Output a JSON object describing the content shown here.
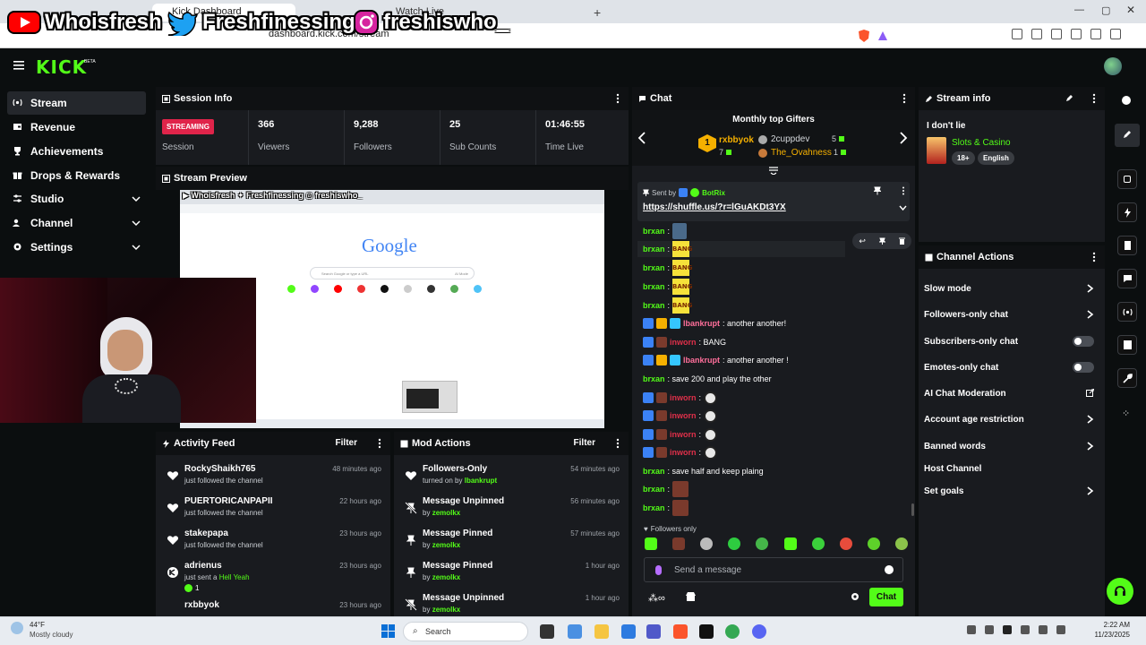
{
  "browser": {
    "tabs": [
      "Kick Dashboard",
      "Watch Live"
    ],
    "url": "dashboard.kick.com/stream"
  },
  "overlay": {
    "youtube": "Whoisfresh",
    "twitter": "Freshfinessing",
    "instagram": "freshiswho_"
  },
  "app": {
    "logo": "KICK",
    "logo_sup": "BETA"
  },
  "sidebar": {
    "items": [
      {
        "label": "Stream"
      },
      {
        "label": "Revenue"
      },
      {
        "label": "Achievements"
      },
      {
        "label": "Drops & Rewards"
      },
      {
        "label": "Studio"
      },
      {
        "label": "Channel"
      },
      {
        "label": "Settings"
      }
    ]
  },
  "session": {
    "title": "Session Info",
    "status": "STREAMING",
    "status_label": "Session",
    "stats": [
      {
        "value": "366",
        "label": "Viewers"
      },
      {
        "value": "9,288",
        "label": "Followers"
      },
      {
        "value": "25",
        "label": "Sub Counts"
      },
      {
        "value": "01:46:55",
        "label": "Time Live"
      }
    ]
  },
  "preview": {
    "title": "Stream Preview",
    "google_logo": "Google",
    "search_placeholder": "Search Google or type a URL",
    "ai_mode": "AI Mode"
  },
  "activity": {
    "title": "Activity Feed",
    "filter": "Filter",
    "items": [
      {
        "name": "RockyShaikh765",
        "sub": "just followed the channel",
        "ago": "48 minutes ago"
      },
      {
        "name": "PUERTORICANPAPII",
        "sub": "just followed the channel",
        "ago": "22 hours ago"
      },
      {
        "name": "stakepapa",
        "sub": "just followed the channel",
        "ago": "23 hours ago"
      },
      {
        "name": "adrienus",
        "sub": "just sent a",
        "sub_green": "Hell Yeah",
        "count": "1",
        "ago": "23 hours ago"
      },
      {
        "name": "rxbbyok",
        "ago": "23 hours ago"
      }
    ]
  },
  "mod": {
    "title": "Mod Actions",
    "filter": "Filter",
    "items": [
      {
        "name": "Followers-Only",
        "sub": "turned on by",
        "user": "lbankrupt",
        "ago": "54 minutes ago"
      },
      {
        "name": "Message Unpinned",
        "sub": "by",
        "user": "zemolkx",
        "ago": "56 minutes ago"
      },
      {
        "name": "Message Pinned",
        "sub": "by",
        "user": "zemolkx",
        "ago": "57 minutes ago"
      },
      {
        "name": "Message Pinned",
        "sub": "by",
        "user": "zemolkx",
        "ago": "1 hour ago"
      },
      {
        "name": "Message Unpinned",
        "sub": "by",
        "user": "zemolkx",
        "ago": "1 hour ago"
      }
    ]
  },
  "chat": {
    "title": "Chat",
    "gifters_title": "Monthly top Gifters",
    "gifters": [
      {
        "rank": "1",
        "name": "rxbbyok",
        "count": "7"
      },
      {
        "name": "2cuppdev",
        "count": "5"
      },
      {
        "name": "The_Ovahness",
        "count": "1"
      }
    ],
    "pinned": {
      "sent_by": "Sent by",
      "user": "BotRix",
      "link": "https://shuffle.us/?r=lGuAKDt3YX"
    },
    "lines": [
      {
        "user": "brxan",
        "text": ""
      },
      {
        "user": "brxan",
        "text": "BANG"
      },
      {
        "user": "brxan",
        "text": "BANG"
      },
      {
        "user": "brxan",
        "text": "BANG"
      },
      {
        "user": "brxan",
        "text": "BANG"
      },
      {
        "user": "lbankrupt",
        "text": ": another another!"
      },
      {
        "user": "inworn",
        "text": ": BANG"
      },
      {
        "user": "lbankrupt",
        "text": ": another another !"
      },
      {
        "user": "brxan",
        "text": ": save 200 and play the other"
      },
      {
        "user": "inworn",
        "text": ""
      },
      {
        "user": "inworn",
        "text": ""
      },
      {
        "user": "inworn",
        "text": ""
      },
      {
        "user": "inworn",
        "text": ""
      },
      {
        "user": "brxan",
        "text": ": save half and keep plaing"
      },
      {
        "user": "brxan",
        "text": ""
      },
      {
        "user": "brxan",
        "text": ""
      }
    ],
    "followers_only": "Followers only",
    "input_placeholder": "Send a message",
    "send_label": "Chat"
  },
  "stream_info": {
    "title": "Stream info",
    "stream_title": "I don't lie",
    "category": "Slots & Casino",
    "tags": [
      "18+",
      "English"
    ]
  },
  "channel_actions": {
    "title": "Channel Actions",
    "items": [
      {
        "label": "Slow mode",
        "kind": "arrow"
      },
      {
        "label": "Followers-only chat",
        "kind": "arrow"
      },
      {
        "label": "Subscribers-only chat",
        "kind": "toggle"
      },
      {
        "label": "Emotes-only chat",
        "kind": "toggle"
      },
      {
        "label": "AI Chat Moderation",
        "kind": "external"
      },
      {
        "label": "Account age restriction",
        "kind": "arrow"
      },
      {
        "label": "Banned words",
        "kind": "arrow"
      },
      {
        "label": "Host Channel",
        "kind": "none"
      },
      {
        "label": "Set goals",
        "kind": "arrow"
      }
    ]
  },
  "taskbar": {
    "weather_temp": "44°F",
    "weather_desc": "Mostly cloudy",
    "search": "Search",
    "time": "2:22 AM",
    "date": "11/23/2025"
  },
  "colors": {
    "accent": "#53fc18",
    "live": "#e0244a",
    "panel": "#191b1f",
    "bg": "#0b0e0f"
  }
}
